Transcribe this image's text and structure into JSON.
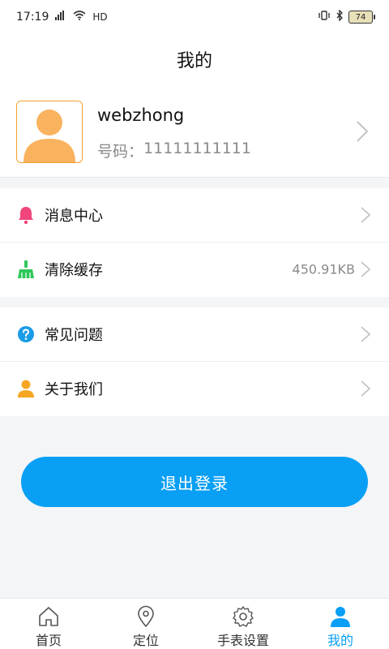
{
  "status_bar": {
    "time": "17:19",
    "network": "HD",
    "battery": "74"
  },
  "header": {
    "title": "我的"
  },
  "profile": {
    "username": "webzhong",
    "phone_label": "号码：",
    "phone_number": "11111111111"
  },
  "menu": {
    "group1": [
      {
        "label": "消息中心",
        "icon": "bell-icon",
        "value": ""
      },
      {
        "label": "清除缓存",
        "icon": "broom-icon",
        "value": "450.91KB"
      }
    ],
    "group2": [
      {
        "label": "常见问题",
        "icon": "question-icon",
        "value": ""
      },
      {
        "label": "关于我们",
        "icon": "person-icon",
        "value": ""
      }
    ]
  },
  "logout_label": "退出登录",
  "tabs": [
    {
      "label": "首页",
      "icon": "home-icon",
      "active": false
    },
    {
      "label": "定位",
      "icon": "location-pin-icon",
      "active": false
    },
    {
      "label": "手表设置",
      "icon": "gear-icon",
      "active": false
    },
    {
      "label": "我的",
      "icon": "user-icon",
      "active": true
    }
  ],
  "colors": {
    "accent": "#099ff4",
    "avatar_orange": "#f9b25e",
    "bell_pink": "#f0457a",
    "broom_green": "#2fc85a",
    "question_blue": "#1a9be8",
    "person_orange": "#f5a623"
  }
}
